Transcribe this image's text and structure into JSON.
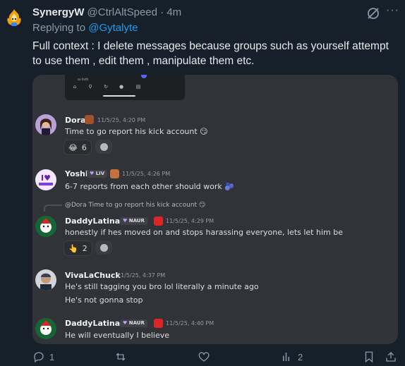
{
  "tweet": {
    "display_name": "SynergyW",
    "handle": "@CtrlAltSpeed",
    "separator": "·",
    "time": "4m",
    "replying_prefix": "Replying to",
    "replying_to": "@Gytalyte",
    "text": "Full context : I delete messages because groups such as yourself attempt to use them , edit them , manipulate them etc."
  },
  "screenshot": {
    "phone_text": "so forth",
    "messages": [
      {
        "username": "Dora",
        "timestamp": "11/5/25, 4:20 PM",
        "text": "Time to go report his kick account 😏",
        "reaction": {
          "emoji": "😂",
          "count": "6"
        }
      },
      {
        "username": "Yoshi",
        "tag": "LIV",
        "timestamp": "11/5/25, 4:26 PM",
        "text": "6-7 reports from each other should work 🫐"
      },
      {
        "reply_ref": "@Dora Time to go report his kick account 😏",
        "username": "DaddyLatina",
        "tag": "NAUR",
        "timestamp": "11/5/25, 4:29 PM",
        "text": "honestly if hes moved on and stops harassing everyone, lets let him be",
        "reaction": {
          "emoji": "👆",
          "count": "2"
        }
      },
      {
        "username": "VivaLaChuck",
        "timestamp": "11/5/25, 4:37 PM",
        "text": "He's still tagging you bro lol literally a minute ago",
        "text2": "He's not gonna stop"
      },
      {
        "username": "DaddyLatina",
        "tag": "NAUR",
        "timestamp": "11/5/25, 4:40 PM",
        "text": "He will eventually I believe"
      }
    ]
  },
  "actions": {
    "reply_count": "1",
    "repost_count": "",
    "like_count": "",
    "views_count": "2"
  },
  "colors": {
    "background": "#15202b",
    "accent": "#1d9bf0",
    "discord_bg": "#313338",
    "muted": "#8b98a5"
  }
}
